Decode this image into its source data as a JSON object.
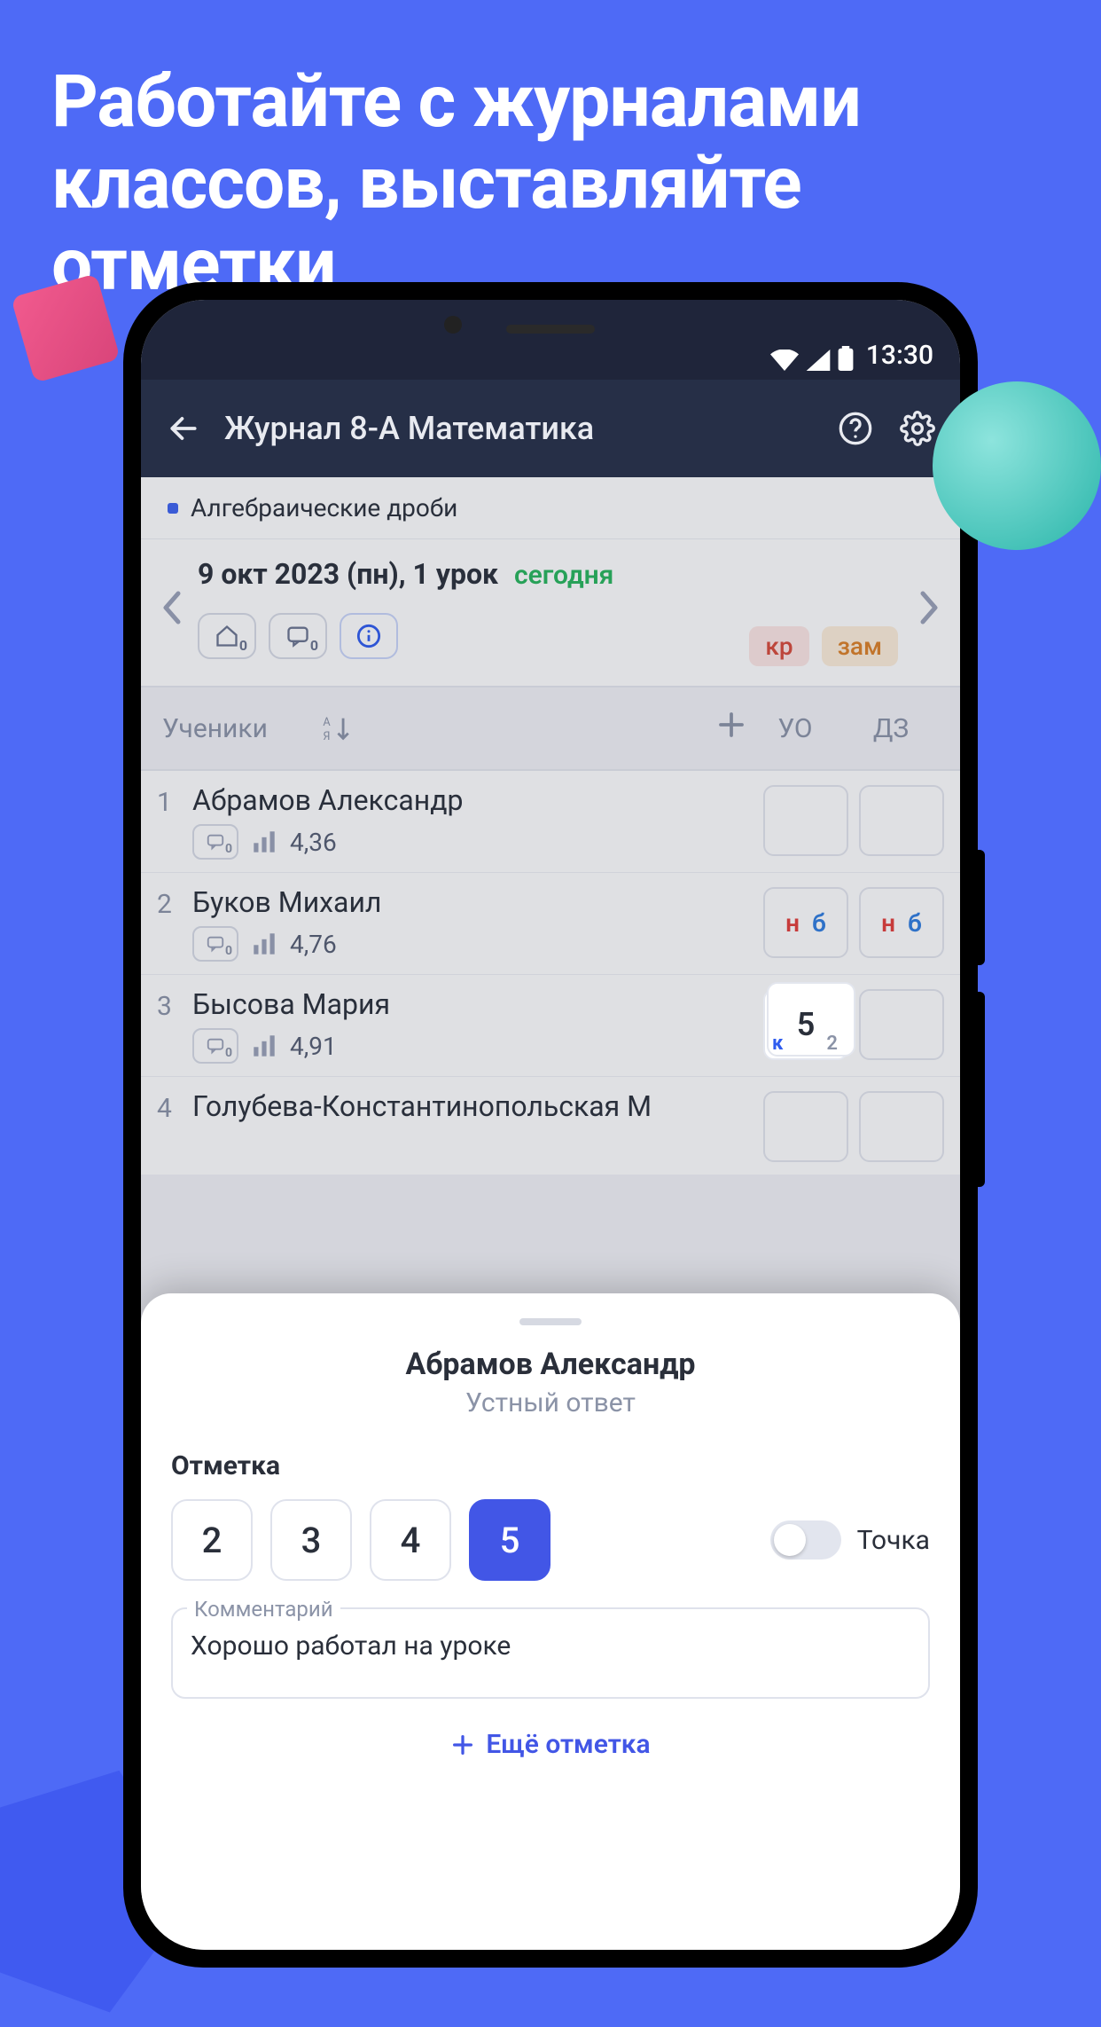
{
  "promo_headline": "Работайте с журналами классов, выставляйте отметки",
  "statusbar": {
    "time": "13:30"
  },
  "appbar": {
    "title": "Журнал 8-А Математика"
  },
  "topic": {
    "label": "Алгебраические дроби"
  },
  "lesson": {
    "date": "9 окт 2023 (пн), 1 урок",
    "today": "сегодня",
    "tag_kr": "кр",
    "tag_zam": "зам"
  },
  "header": {
    "students": "Ученики",
    "col_uo": "УО",
    "col_dz": "ДЗ"
  },
  "students": [
    {
      "num": "1",
      "name": "Абрамов Александр",
      "avg": "4,36"
    },
    {
      "num": "2",
      "name": "Буков Михаил",
      "avg": "4,76",
      "uo_n": "н",
      "uo_b": "б",
      "dz_n": "н",
      "dz_b": "б"
    },
    {
      "num": "3",
      "name": "Бысова Мария",
      "avg": "4,91",
      "uo_val": "5",
      "uo_k": "к",
      "uo_cnt": "2"
    },
    {
      "num": "4",
      "name": "Голубева-Константинопольская М"
    }
  ],
  "sheet": {
    "student": "Абрамов Александр",
    "gradetype": "Устный ответ",
    "mark_label": "Отметка",
    "grades": [
      "2",
      "3",
      "4",
      "5"
    ],
    "selected": "5",
    "dot_label": "Точка",
    "comment_label": "Комментарий",
    "comment_text": "Хорошо работал на уроке",
    "add_more": "Ещё отметка"
  }
}
